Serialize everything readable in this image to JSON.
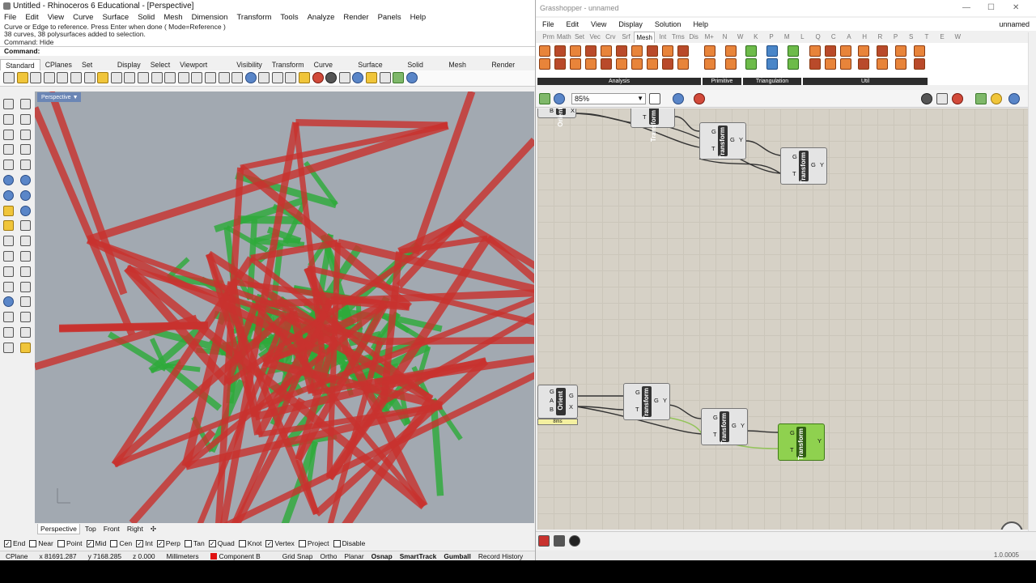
{
  "rhino": {
    "title": "Untitled - Rhinoceros 6 Educational - [Perspective]",
    "menu": [
      "File",
      "Edit",
      "View",
      "Curve",
      "Surface",
      "Solid",
      "Mesh",
      "Dimension",
      "Transform",
      "Tools",
      "Analyze",
      "Render",
      "Panels",
      "Help"
    ],
    "history": [
      "Curve or Edge to reference. Press Enter when done ( Mode=Reference )",
      "38 curves, 38 polysurfaces added to selection.",
      "Command: Hide"
    ],
    "prompt": "Command:",
    "toolbar_tabs": [
      "Standard",
      "CPlanes",
      "Set View",
      "Display",
      "Select",
      "Viewport Layout",
      "Visibility",
      "Transform",
      "Curve Tools",
      "Surface Tools",
      "Solid Tools",
      "Mesh Tools",
      "Render Tools"
    ],
    "viewport_label": "Perspective",
    "viewport_tabs": [
      "Perspective",
      "Top",
      "Front",
      "Right"
    ],
    "osnaps": [
      {
        "label": "End",
        "checked": true
      },
      {
        "label": "Near",
        "checked": false
      },
      {
        "label": "Point",
        "checked": false
      },
      {
        "label": "Mid",
        "checked": true
      },
      {
        "label": "Cen",
        "checked": false
      },
      {
        "label": "Int",
        "checked": true
      },
      {
        "label": "Perp",
        "checked": true
      },
      {
        "label": "Tan",
        "checked": false
      },
      {
        "label": "Quad",
        "checked": true
      },
      {
        "label": "Knot",
        "checked": false
      },
      {
        "label": "Vertex",
        "checked": true
      },
      {
        "label": "Project",
        "checked": false
      },
      {
        "label": "Disable",
        "checked": false
      }
    ],
    "status": {
      "cplane": "CPlane",
      "x": "x 81691.287",
      "y": "y 7168.285",
      "z": "z 0.000",
      "units": "Millimeters",
      "layer": "Component B",
      "layer_color": "#e01010",
      "toggles": [
        "Grid Snap",
        "Ortho",
        "Planar",
        "Osnap",
        "SmartTrack",
        "Gumball",
        "Record History"
      ],
      "bold_toggles": [
        "Osnap",
        "SmartTrack",
        "Gumball"
      ]
    },
    "colors": {
      "red_members": "#c8322e",
      "green_members": "#2ea93a",
      "viewport_bg": "#a2a9b1"
    }
  },
  "grasshopper": {
    "title": "Grasshopper - unnamed",
    "doc_name": "unnamed",
    "menu": [
      "File",
      "Edit",
      "View",
      "Display",
      "Solution",
      "Help"
    ],
    "tabs": [
      "Prm",
      "Math",
      "Set",
      "Vec",
      "Crv",
      "Srf",
      "Mesh",
      "Int",
      "Trns",
      "Dis",
      "M+",
      "N",
      "W",
      "K",
      "P",
      "M",
      "L",
      "Q",
      "C",
      "A",
      "H",
      "R",
      "P",
      "S",
      "T",
      "E",
      "W"
    ],
    "active_tab": "Mesh",
    "ribbon_groups": [
      "Analysis",
      "Primitive",
      "Triangulation",
      "Util"
    ],
    "zoom": "85%",
    "version": "1.0.0005",
    "components": [
      {
        "name": "Orient",
        "ports_in": [
          "G",
          "A",
          "B"
        ],
        "ports_out": [
          "G",
          "X"
        ]
      },
      {
        "name": "Transform",
        "ports_in": [
          "G",
          "T"
        ],
        "ports_out": [
          "G",
          "Y"
        ]
      },
      {
        "name": "Transform",
        "ports_in": [
          "G",
          "T"
        ],
        "ports_out": [
          "G",
          "Y"
        ]
      },
      {
        "name": "Transform",
        "ports_in": [
          "G",
          "T"
        ],
        "ports_out": [
          "G",
          "Y"
        ]
      },
      {
        "name": "Orient",
        "ports_in": [
          "G",
          "A",
          "B"
        ],
        "ports_out": [
          "G",
          "X"
        ],
        "timer": "8ms"
      },
      {
        "name": "Transform",
        "ports_in": [
          "G",
          "T"
        ],
        "ports_out": [
          "G",
          "Y"
        ]
      },
      {
        "name": "Transform",
        "ports_in": [
          "G",
          "T"
        ],
        "ports_out": [
          "G",
          "Y"
        ]
      },
      {
        "name": "Transform",
        "ports_in": [
          "G",
          "T"
        ],
        "ports_out": [
          "G",
          "Y"
        ],
        "selected": true
      }
    ],
    "colors": {
      "canvas": "#d6d1c6",
      "selected": "#8fd14f",
      "wire_selected": "#93c45a"
    }
  }
}
